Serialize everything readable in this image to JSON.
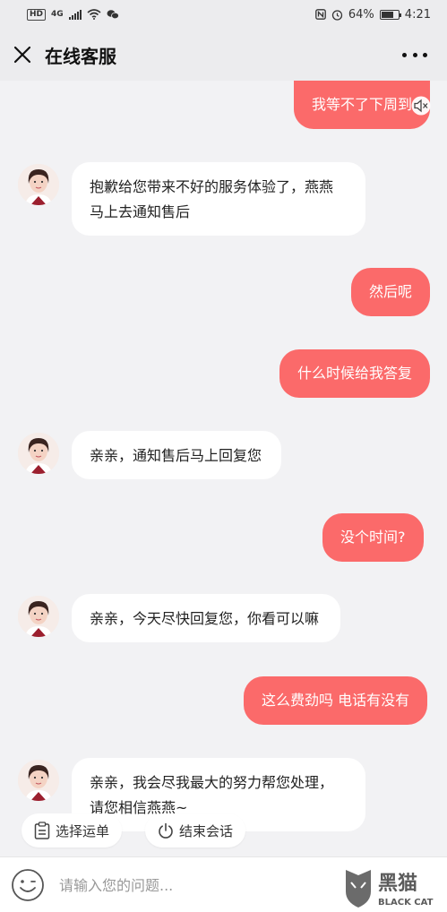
{
  "status_bar": {
    "hd": "HD",
    "network": "4G",
    "battery_percent": "64%",
    "time": "4:21"
  },
  "header": {
    "title": "在线客服"
  },
  "messages": [
    {
      "sender": "user",
      "text": "我等不了下周到"
    },
    {
      "sender": "agent",
      "line1": "抱歉给您带来不好的服务体验了，燕燕",
      "line2": "马上去通知售后"
    },
    {
      "sender": "user",
      "text": "然后呢"
    },
    {
      "sender": "user",
      "text": "什么时候给我答复"
    },
    {
      "sender": "agent",
      "line1": "亲亲，通知售后马上回复您"
    },
    {
      "sender": "user",
      "text": "没个时间?"
    },
    {
      "sender": "agent",
      "line1": "亲亲，今天尽快回复您，你看可以嘛"
    },
    {
      "sender": "user",
      "text": "这么费劲吗  电话有没有"
    },
    {
      "sender": "agent",
      "line1": "亲亲，我会尽我最大的努力帮您处理，",
      "line2": "请您相信燕燕~"
    }
  ],
  "quick_actions": {
    "select_order": "选择运单",
    "end_chat": "结束会话"
  },
  "input": {
    "placeholder": "请输入您的问题..."
  },
  "watermark": {
    "cn": "黑猫",
    "en": "BLACK CAT"
  },
  "colors": {
    "user_bubble": "#fb6a6a",
    "agent_bubble": "#ffffff",
    "background": "#f2f2f4"
  }
}
